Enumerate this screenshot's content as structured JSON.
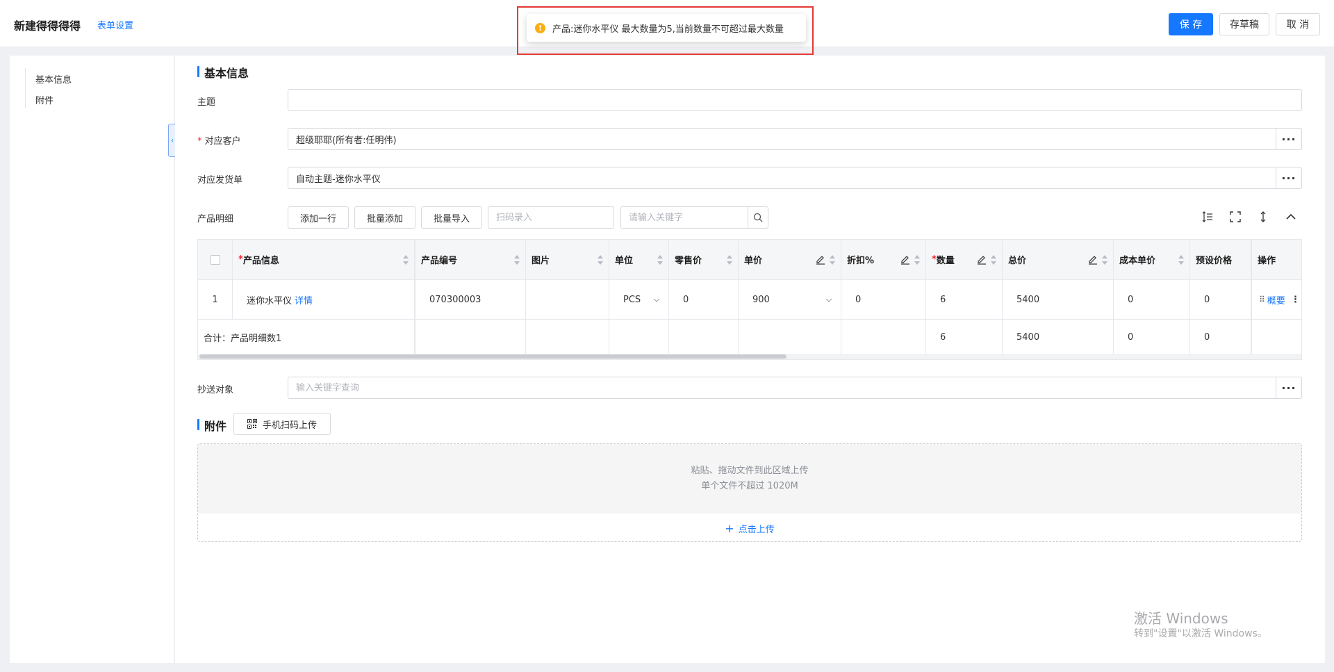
{
  "header": {
    "title": "新建得得得得",
    "settings_link": "表单设置",
    "save": "保 存",
    "draft": "存草稿",
    "cancel": "取 消"
  },
  "toast": {
    "icon": "!",
    "message": "产品:迷你水平仪 最大数量为5,当前数量不可超过最大数量",
    "accent": "#faad14",
    "highlight": "#e53935"
  },
  "sidebar": {
    "items": [
      {
        "label": "基本信息"
      },
      {
        "label": "附件"
      }
    ]
  },
  "basic": {
    "section_title": "基本信息",
    "subject_label": "主题",
    "subject_value": "",
    "customer_label": "对应客户",
    "customer_required": "*",
    "customer_value": "超级耶耶(所有者:任明伟)",
    "delivery_label": "对应发货单",
    "delivery_value": "自动主题-迷你水平仪",
    "dots": "···"
  },
  "products": {
    "label": "产品明细",
    "add_row": "添加一行",
    "batch_add": "批量添加",
    "batch_import": "批量导入",
    "scan_placeholder": "扫码录入",
    "keyword_placeholder": "请输入关键字",
    "columns": [
      {
        "label": "",
        "required": ""
      },
      {
        "label": "产品信息",
        "required": "*"
      },
      {
        "label": "产品编号",
        "required": ""
      },
      {
        "label": "图片",
        "required": ""
      },
      {
        "label": "单位",
        "required": ""
      },
      {
        "label": "零售价",
        "required": ""
      },
      {
        "label": "单价",
        "required": ""
      },
      {
        "label": "折扣%",
        "required": ""
      },
      {
        "label": "数量",
        "required": "*"
      },
      {
        "label": "总价",
        "required": ""
      },
      {
        "label": "成本单价",
        "required": ""
      },
      {
        "label": "预设价格",
        "required": ""
      },
      {
        "label": "操作",
        "required": ""
      }
    ],
    "rows": [
      {
        "index": "1",
        "name": "迷你水平仪",
        "detail_link": "详情",
        "code": "070300003",
        "image": "",
        "unit": "PCS",
        "retail": "0",
        "price": "900",
        "discount": "0",
        "qty": "6",
        "total": "5400",
        "cost": "0",
        "preset": "0",
        "action_link": "概要"
      }
    ],
    "summary": {
      "label": "合计：产品明细数1",
      "qty": "6",
      "total": "5400",
      "cost": "0",
      "preset": "0"
    }
  },
  "cc": {
    "label": "抄送对象",
    "placeholder": "输入关键字查询",
    "dots": "···"
  },
  "attachment": {
    "section_title": "附件",
    "qr_upload": "手机扫码上传",
    "drop_hint": "粘贴、拖动文件到此区域上传",
    "size_hint": "单个文件不超过 1020M",
    "upload_link": "点击上传"
  },
  "watermark": {
    "title": "激活 Windows",
    "subtitle": "转到\"设置\"以激活 Windows。"
  }
}
